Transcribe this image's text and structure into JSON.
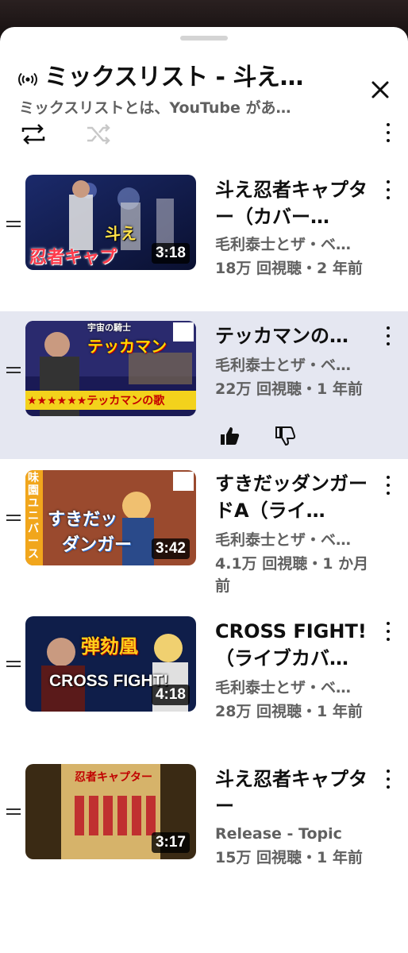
{
  "header": {
    "title": "ミックスリスト - 斗え…",
    "subtitle": "ミックスリストとは、YouTube があ…"
  },
  "controls": {
    "icons": [
      "loop-icon",
      "shuffle-icon",
      "more-vert-icon"
    ]
  },
  "playlist": [
    {
      "title": "斗え忍者キャプター（カバー…",
      "channel": "毛利泰士とザ・ベ…",
      "meta": "18万 回視聴・2 年前",
      "duration": "3:18",
      "thumb_text": [
        "斗え",
        "忍者キャプ"
      ],
      "active": false
    },
    {
      "title": "テッカマンの…",
      "channel": "毛利泰士とザ・ベ…",
      "meta": "22万 回視聴・1 年前",
      "duration": "",
      "thumb_text": [
        "宇宙の騎士",
        "テッカマン",
        "★★★★★★テッカマンの歌"
      ],
      "active": true
    },
    {
      "title": "すきだッダンガードA（ライ…",
      "channel": "毛利泰士とザ・ベ…",
      "meta": "4.1万 回視聴・1 か月前",
      "duration": "3:42",
      "thumb_text": [
        "すきだッ",
        "ダンガー",
        "味園ユニバース"
      ],
      "active": false
    },
    {
      "title": "CROSS FIGHT!（ライブカバ…",
      "channel": "毛利泰士とザ・ベ…",
      "meta": "28万 回視聴・1 年前",
      "duration": "4:18",
      "thumb_text": [
        "弾劾凰",
        "CROSS FIGHT!"
      ],
      "active": false
    },
    {
      "title": "斗え忍者キャプター",
      "channel": "Release - Topic",
      "meta": "15万 回視聴・1 年前",
      "duration": "3:17",
      "thumb_text": [
        "忍者キャプター"
      ],
      "active": false
    }
  ],
  "colors": {
    "active_row": "#e5e7f1",
    "secondary_text": "#606060",
    "primary_text": "#0f0f0f"
  }
}
